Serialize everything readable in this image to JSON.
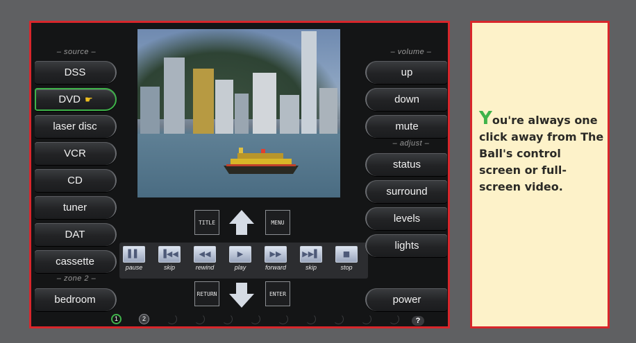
{
  "source": {
    "label": "– source –",
    "items": [
      {
        "label": "DSS"
      },
      {
        "label": "DVD"
      },
      {
        "label": "laser disc"
      },
      {
        "label": "VCR"
      },
      {
        "label": "CD"
      },
      {
        "label": "tuner"
      },
      {
        "label": "DAT"
      },
      {
        "label": "cassette"
      }
    ],
    "active_item": "DVD"
  },
  "zone2": {
    "label": "– zone 2 –",
    "item": "bedroom"
  },
  "volume": {
    "label": "– volume –",
    "items": [
      {
        "label": "up"
      },
      {
        "label": "down"
      },
      {
        "label": "mute"
      }
    ]
  },
  "adjust": {
    "label": "– adjust –",
    "items": [
      {
        "label": "status"
      },
      {
        "label": "surround"
      },
      {
        "label": "levels"
      },
      {
        "label": "lights"
      }
    ]
  },
  "power": {
    "label": "power"
  },
  "nav": {
    "title": "TITLE",
    "menu": "MENU",
    "return": "RETURN",
    "enter": "ENTER"
  },
  "transport": [
    {
      "glyph": "▌▌",
      "label": "pause"
    },
    {
      "glyph": "▐◀◀",
      "label": "skip"
    },
    {
      "glyph": "◀◀",
      "label": "rewind"
    },
    {
      "glyph": "▶",
      "label": "play"
    },
    {
      "glyph": "▶▶",
      "label": "forward"
    },
    {
      "glyph": "▶▶▌",
      "label": "skip"
    },
    {
      "glyph": "■",
      "label": "stop"
    }
  ],
  "pages": {
    "page1": "1",
    "page2": "2",
    "help": "?"
  },
  "caption": {
    "first_letter": "Y",
    "text": "ou're always one click away from The Ball's control screen or full-screen video."
  },
  "colors": {
    "frame_red": "#d8262b",
    "active_green": "#3fb34a",
    "card_bg": "#fdf2c9"
  }
}
